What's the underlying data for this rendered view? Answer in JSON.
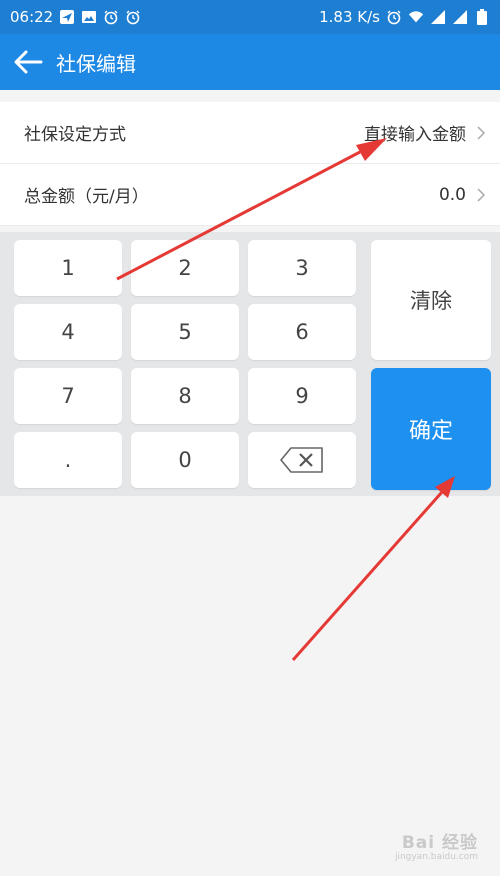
{
  "status_bar": {
    "time": "06:22",
    "speed": "1.83 K/s",
    "icons": [
      "paper-plane-icon",
      "image-icon",
      "alarm-icon",
      "alarm-icon",
      "alarm-icon",
      "wifi-icon",
      "signal-icon",
      "battery-icon"
    ]
  },
  "app_bar": {
    "title": "社保编辑"
  },
  "form": {
    "rows": [
      {
        "label": "社保设定方式",
        "value": "直接输入金额"
      },
      {
        "label": "总金额（元/月）",
        "value": "0.0"
      }
    ]
  },
  "keypad": {
    "keys": [
      "1",
      "2",
      "3",
      "4",
      "5",
      "6",
      "7",
      "8",
      "9",
      ".",
      "0"
    ],
    "clear_label": "清除",
    "confirm_label": "确定"
  },
  "watermark": {
    "main": "Bai 经验",
    "sub": "jingyan.baidu.com"
  },
  "colors": {
    "app_bar": "#1e88e5",
    "confirm": "#1e90f0",
    "arrow": "#e53935"
  }
}
